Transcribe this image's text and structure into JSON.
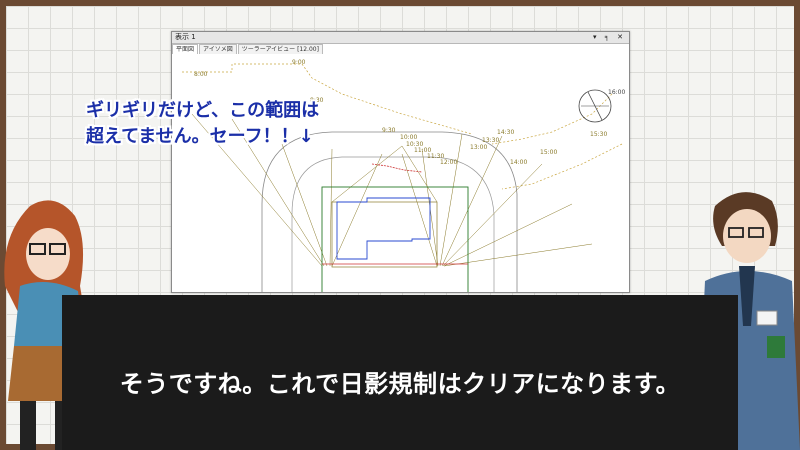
{
  "window": {
    "title": "表示 1",
    "controls": "▾ ╕ ✕",
    "tabs": [
      "平面図",
      "アイソメ図",
      "ツーラーアイビュー [12.00]"
    ]
  },
  "drawing": {
    "time_labels": [
      "8:00",
      "9:00",
      "8:30",
      "9:30",
      "10:00",
      "10:30",
      "11:00",
      "11:30",
      "12:00",
      "13:00",
      "13:30",
      "14:00",
      "14:30",
      "15:00",
      "15:30",
      "16:00"
    ],
    "compass_label": "16:00"
  },
  "caption": {
    "line1": "ギリギリだけど、この範囲は",
    "line2": "超えてません。セーフ！！↓"
  },
  "subtitle": "そうですね。これで日影規制はクリアになります。",
  "colors": {
    "frame": "#6b4a33",
    "board": "#f4f4f1",
    "caption": "#1b2fa8",
    "subtitle_bar": "#1b1b1b",
    "shadow_lines": "#8a7a2a",
    "building_outline": "#2a7a2a",
    "building_inner": "#2a4ad0",
    "sun_path": "#c9a640"
  }
}
